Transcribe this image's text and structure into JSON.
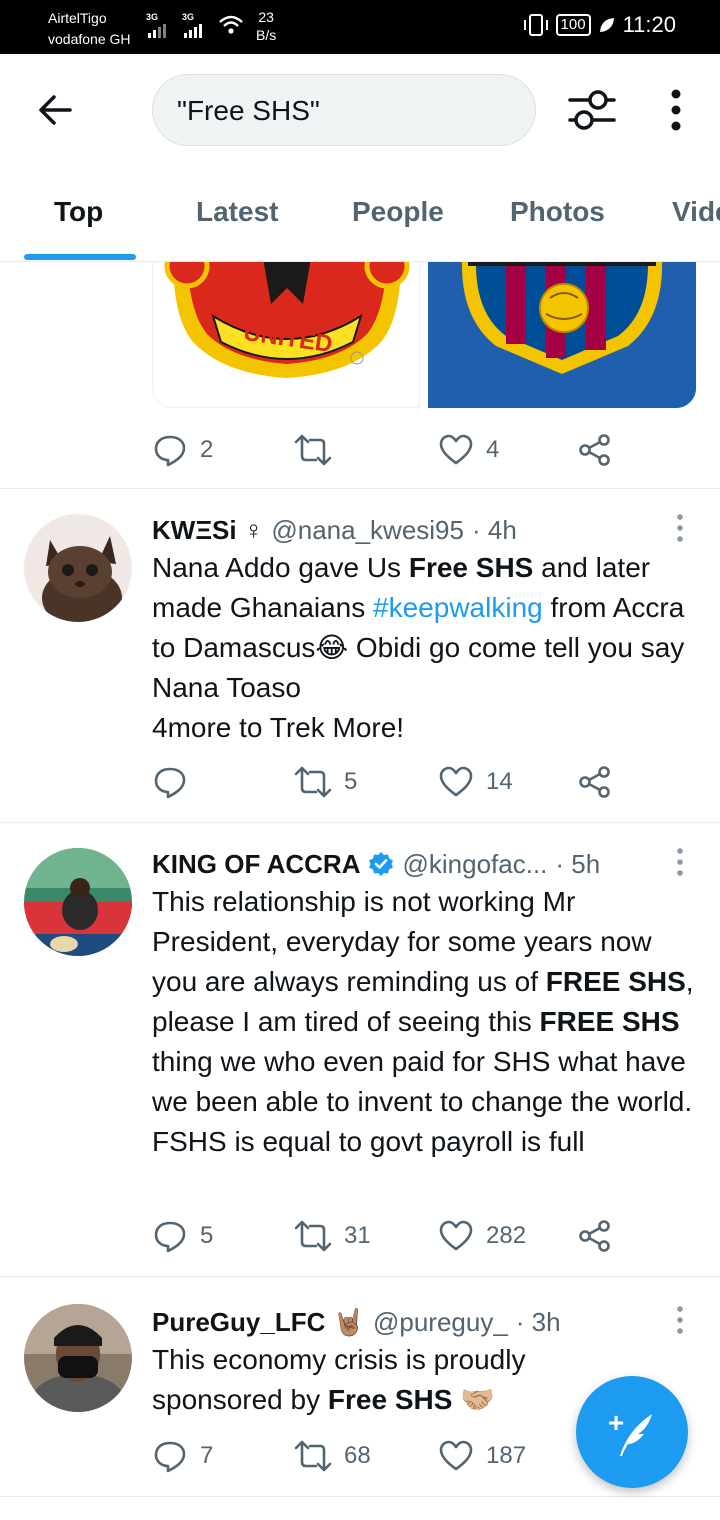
{
  "status_bar": {
    "carrier_1": "AirtelTigo",
    "carrier_2": "vodafone GH",
    "network_1": "3G",
    "network_2": "3G",
    "speed_value": "23",
    "speed_unit": "B/s",
    "battery": "100",
    "time": "11:20"
  },
  "header": {
    "search_query": "\"Free SHS\"",
    "back_icon": "arrow-left-icon",
    "filter_icon": "sliders-icon",
    "more_icon": "vertical-dots-icon"
  },
  "tabs": [
    {
      "label": "Top",
      "active": true
    },
    {
      "label": "Latest",
      "active": false
    },
    {
      "label": "People",
      "active": false
    },
    {
      "label": "Photos",
      "active": false
    },
    {
      "label": "Videos",
      "active": false
    }
  ],
  "partial_tweet": {
    "media_left_text": "UNITED",
    "replies": "2",
    "retweets": "",
    "likes": "4"
  },
  "tweets": [
    {
      "name": "KWΞSi ♀",
      "handle": "@nana_kwesi95",
      "time": "· 4h",
      "t1": "Nana Addo gave Us ",
      "b1": "Free SHS",
      "t2": " and later made Ghanaians ",
      "hashtag": "#keepwalking",
      "t3": " from Accra to Damascus😂 Obidi go come tell you say Nana Toaso",
      "line_last": "4more to Trek More!",
      "replies": "",
      "retweets": "5",
      "likes": "14"
    },
    {
      "name": "KING OF ACCRA",
      "handle": "@kingofac...",
      "time": "· 5h",
      "t1": "This relationship is not working Mr President, everyday for some years now you are always reminding us of ",
      "b1": "FREE SHS",
      "t2": ", please I am tired of seeing this ",
      "b2": "FREE SHS",
      "t3": " thing we who even paid for SHS what have we been able to invent to change the world. FSHS is equal to govt payroll is full",
      "replies": "5",
      "retweets": "31",
      "likes": "282"
    },
    {
      "name": "PureGuy_LFC 🤘🏽",
      "handle": "@pureguy_",
      "time": "· 3h",
      "t1": "This economy crisis is proudly sponsored by ",
      "b1": "Free SHS",
      "t2": " 🤝🏼",
      "replies": "7",
      "retweets": "68",
      "likes": "187"
    }
  ],
  "fab": {
    "icon": "compose-tweet-icon",
    "symbol": "+"
  },
  "colors": {
    "accent": "#1d9bf0",
    "muted": "#536471",
    "text": "#0f1419",
    "divider": "#e6ecf0"
  }
}
